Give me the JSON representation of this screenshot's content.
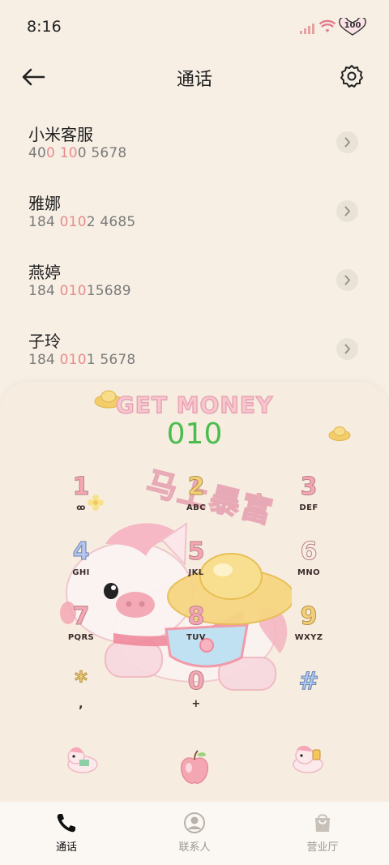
{
  "status": {
    "time": "8:16",
    "battery": "100"
  },
  "header": {
    "title": "通话"
  },
  "contacts": [
    {
      "name": "小米客服",
      "num_parts": [
        "40",
        "0",
        " ",
        "10",
        "0 5678"
      ]
    },
    {
      "name": "雅娜",
      "num_parts": [
        "184 ",
        "010",
        "2 4685",
        "",
        ""
      ]
    },
    {
      "name": "燕婷",
      "num_parts": [
        "184 ",
        "010",
        "15689",
        "",
        ""
      ]
    },
    {
      "name": "子玲",
      "num_parts": [
        "184 ",
        "010",
        "1 5678",
        "",
        ""
      ]
    }
  ],
  "dialpad": {
    "brand": "GET MONEY",
    "entered_number": "010",
    "theme_text": "马上暴富",
    "keys": [
      {
        "digit": "1",
        "letters": "ꝏ"
      },
      {
        "digit": "2",
        "letters": "ABC"
      },
      {
        "digit": "3",
        "letters": "DEF"
      },
      {
        "digit": "4",
        "letters": "GHI"
      },
      {
        "digit": "5",
        "letters": "JKL"
      },
      {
        "digit": "6",
        "letters": "MNO"
      },
      {
        "digit": "7",
        "letters": "PQRS"
      },
      {
        "digit": "8",
        "letters": "TUV"
      },
      {
        "digit": "9",
        "letters": "WXYZ"
      },
      {
        "digit": "*",
        "letters": ","
      },
      {
        "digit": "0",
        "letters": "+"
      },
      {
        "digit": "#",
        "letters": ""
      }
    ],
    "key_colors": [
      "#f4a7b3",
      "#f3cf7a",
      "#a8d0ef",
      "#b4c6ef",
      "#f4a7b3",
      "#f3cf7a",
      "#f4a7b3",
      "#f4a7b3",
      "#f3cf7a",
      "#f3cf7a",
      "#f4a7b3",
      "#a8c8ef"
    ]
  },
  "nav": [
    {
      "label": "通话",
      "active": true
    },
    {
      "label": "联系人",
      "active": false
    },
    {
      "label": "营业厅",
      "active": false
    }
  ],
  "colors": {
    "accent_green": "#4bbd4f",
    "highlight_pink": "#e88b8b",
    "background": "#f7efe4"
  }
}
